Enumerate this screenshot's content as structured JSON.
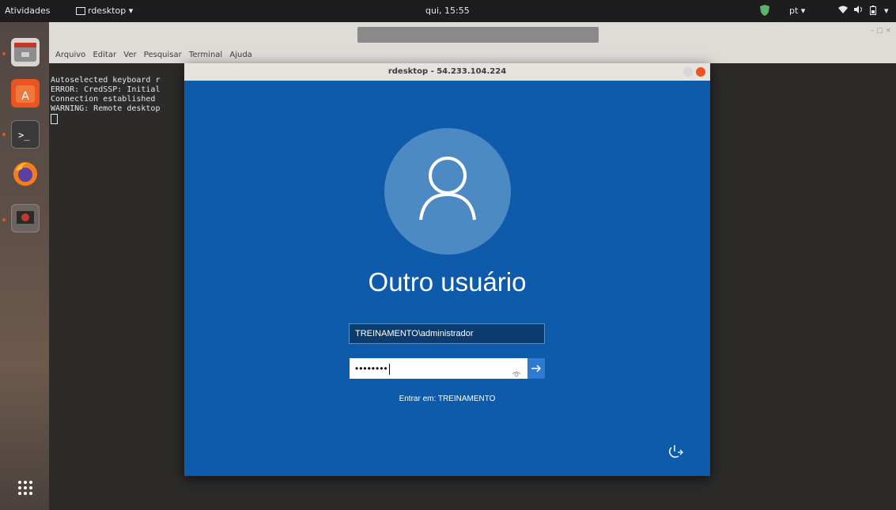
{
  "topbar": {
    "activities": "Atividades",
    "app_name": "rdesktop",
    "clock": "qui, 15:55",
    "language": "pt"
  },
  "terminal": {
    "menu": [
      "Arquivo",
      "Editar",
      "Ver",
      "Pesquisar",
      "Terminal",
      "Ajuda"
    ],
    "lines": [
      "Autoselected keyboard r",
      "ERROR: CredSSP: Initial",
      "Connection established ",
      "WARNING: Remote desktop"
    ]
  },
  "rdesktop": {
    "title": "rdesktop - 54.233.104.224",
    "login": {
      "user_name": "Outro usuário",
      "username_value": "TREINAMENTO\\administrador",
      "password_mask": "••••••••",
      "signin_to": "Entrar em: TREINAMENTO"
    }
  },
  "colors": {
    "login_bg": "#0e5bab",
    "avatar_bg": "#4d8ac4",
    "accent": "#e95420"
  }
}
